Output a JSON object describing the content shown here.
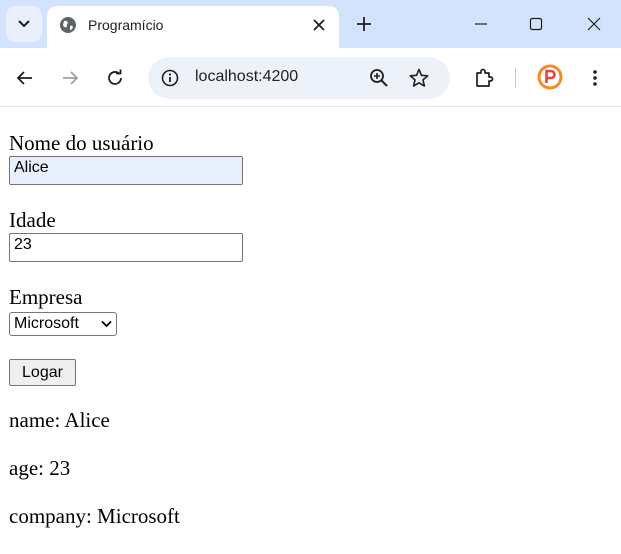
{
  "browser": {
    "tab_title": "Programício",
    "url": "localhost:4200"
  },
  "form": {
    "name_label": "Nome do usuário",
    "name_value": "Alice",
    "age_label": "Idade",
    "age_value": "23",
    "company_label": "Empresa",
    "company_selected": "Microsoft",
    "login_button": "Logar"
  },
  "output": {
    "name_line": "name: Alice",
    "age_line": "age: 23",
    "company_line": "company: Microsoft"
  },
  "colors": {
    "tabstrip_bg": "#d3e3fd",
    "omnibox_bg": "#edf2fa",
    "autofill_bg": "#e8f0fe",
    "profile_orange": "#f28b22"
  },
  "icons": [
    "tab-search-icon",
    "globe-icon",
    "close-icon",
    "plus-icon",
    "minimize-icon",
    "maximize-icon",
    "back-arrow-icon",
    "forward-arrow-icon",
    "reload-icon",
    "site-info-icon",
    "zoom-icon",
    "star-icon",
    "extensions-icon",
    "profile-icon",
    "kebab-menu-icon",
    "chevron-down-icon"
  ]
}
